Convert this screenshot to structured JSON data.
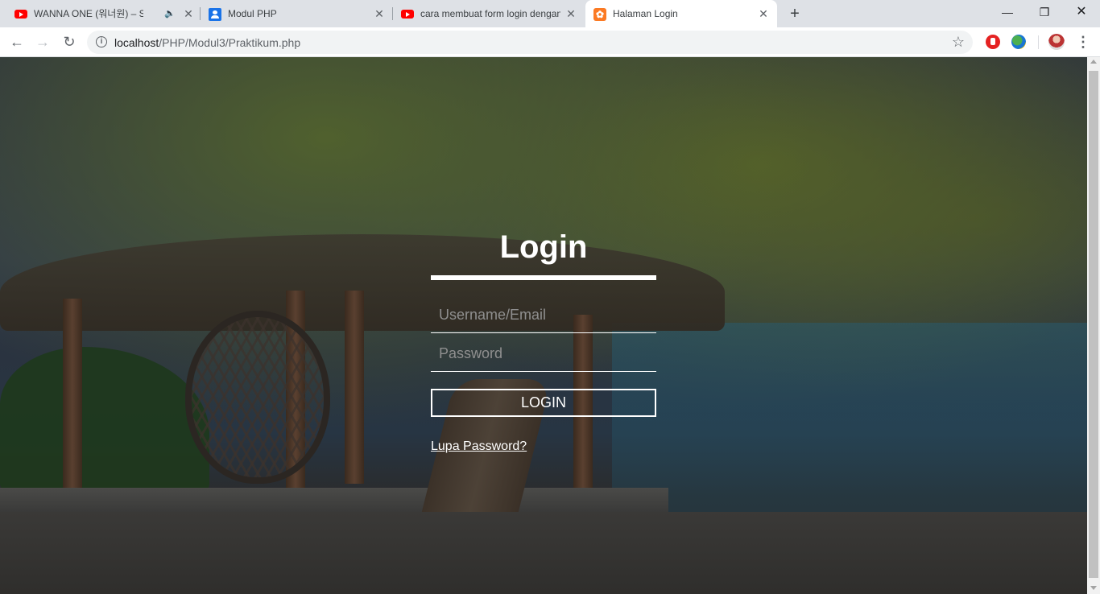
{
  "browser": {
    "tabs": [
      {
        "title": "WANNA ONE (워너원) – SPRI",
        "favicon": "youtube-icon",
        "audio": true
      },
      {
        "title": "Modul PHP",
        "favicon": "google-classroom-icon"
      },
      {
        "title": "cara membuat form login dengan",
        "favicon": "youtube-icon"
      },
      {
        "title": "Halaman Login",
        "favicon": "xampp-icon",
        "active": true
      }
    ],
    "new_tab_label": "+",
    "url_host": "localhost",
    "url_path": "/PHP/Modul3/Praktikum.php",
    "colors": {
      "tabstrip": "#dee1e6",
      "youtube": "#ff0000",
      "xampp": "#fb7a24"
    }
  },
  "login": {
    "title": "Login",
    "username_placeholder": "Username/Email",
    "password_placeholder": "Password",
    "button_label": "LOGIN",
    "forgot_link": "Lupa Password?"
  }
}
